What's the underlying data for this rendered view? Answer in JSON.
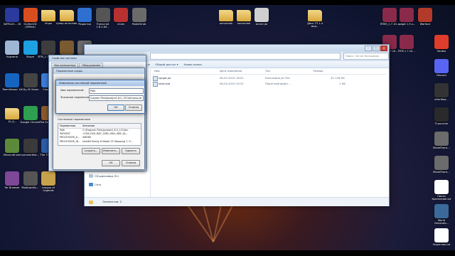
{
  "desktop": {
    "icons_left": [
      {
        "label": "VAPELUC... ID",
        "icon": "app-icon",
        "color": "#2b3a9c"
      },
      {
        "label": "Outline2D (Offline)",
        "icon": "app-icon",
        "color": "#d94e1f"
      },
      {
        "label": "Игры",
        "icon": "folder-icon",
        "color": "#e8c25a"
      },
      {
        "label": "супер источник",
        "icon": "folder-icon",
        "color": "#e8c25a"
      },
      {
        "label": "Редактор",
        "icon": "app-icon",
        "color": "#2f6fd0"
      },
      {
        "label": "Transcript 1.8.2.84...",
        "icon": "app-icon",
        "color": "#555555"
      },
      {
        "label": "vCam",
        "icon": "app-icon",
        "color": "#b73131"
      },
      {
        "label": "ModelGrab",
        "icon": "app-icon",
        "color": "#6b6b6b"
      },
      {
        "label": "Корзина",
        "icon": "trash-icon",
        "color": "#9fb7d4"
      },
      {
        "label": "Skype",
        "icon": "skype-icon",
        "color": "#1da1e2"
      },
      {
        "label": "RTM_1.7.10 Trial",
        "icon": "app-icon",
        "color": "#3d3d3d"
      },
      {
        "label": "Tac_Mash...",
        "icon": "app-icon",
        "color": "#7a5a30"
      },
      {
        "label": "ModelTrans...",
        "icon": "app-icon",
        "color": "#6b6b6b"
      },
      {
        "label": "ModelTrans...",
        "icon": "app-icon",
        "color": "#6b6b6b"
      },
      {
        "label": "Acrobat Reader DC",
        "icon": "acrobat-icon",
        "color": "#d81f1f"
      },
      {
        "label": "mcte",
        "icon": "app-icon",
        "color": "#3a3a3a"
      },
      {
        "label": "TeamViewer 14",
        "icon": "teamviewer-icon",
        "color": "#1565c0"
      },
      {
        "label": "City Of Vision",
        "icon": "app-icon",
        "color": "#444444"
      },
      {
        "label": "Cloudish",
        "icon": "app-icon",
        "color": "#3b7bd6"
      },
      {
        "label": "Downloads",
        "icon": "folder-icon",
        "color": "#e8c25a"
      },
      {
        "label": "desktop.ini",
        "icon": "file-icon",
        "color": "#cccccc"
      },
      {
        "label": "Brit...",
        "icon": "app-icon",
        "color": "#777777"
      },
      {
        "label": "Epic Games Launcher",
        "icon": "epic-icon",
        "color": "#222222"
      },
      {
        "label": "stations_mod",
        "icon": "folder-icon",
        "color": "#e8c25a"
      },
      {
        "label": "10_fj...",
        "icon": "folder-icon",
        "color": "#e8c25a"
      },
      {
        "label": "Google Chrome",
        "icon": "chrome-icon",
        "color": "#2e9e4f"
      },
      {
        "label": "The Escapists",
        "icon": "game-icon",
        "color": "#8a5a2b"
      },
      {
        "label": "ирис 2.1.2.76...",
        "icon": "app-icon",
        "color": "#5f8f3a"
      },
      {
        "label": "MRLaunch...",
        "icon": "app-icon",
        "color": "#444444"
      },
      {
        "label": "Rocket... OEP13",
        "icon": "app-icon",
        "color": "#555555"
      },
      {
        "label": "OBS Studio",
        "icon": "obs-icon",
        "color": "#302e31"
      },
      {
        "label": "MSI Afterburner",
        "icon": "msi-icon",
        "color": "#b71c1c"
      },
      {
        "label": "Minecraft.exe",
        "icon": "minecraft-icon",
        "color": "#5d8a3a"
      },
      {
        "label": "summerfest...",
        "icon": "app-icon",
        "color": "#3a3a3a"
      },
      {
        "label": "The Thunder",
        "icon": "app-icon",
        "color": "#2b5ea8"
      },
      {
        "label": "The Escapists 2",
        "icon": "game-icon",
        "color": "#8a5a2b"
      },
      {
        "label": "QBitF 2.10.10",
        "icon": "app-icon",
        "color": "#777777"
      },
      {
        "label": "OpenVPN GUI",
        "icon": "openvpn-icon",
        "color": "#e05a1c"
      },
      {
        "label": "AutoClicker",
        "icon": "app-icon",
        "color": "#4a4a4a"
      },
      {
        "label": "scd_pack_3...",
        "icon": "app-icon",
        "color": "#6a6a6a"
      },
      {
        "label": "Tor Browser",
        "icon": "tor-icon",
        "color": "#7e4798"
      },
      {
        "label": "ModLoad0x...",
        "icon": "app-icon",
        "color": "#555555"
      },
      {
        "label": "League of Legends",
        "icon": "lol-icon",
        "color": "#c8a24a"
      }
    ],
    "icons_top_right": [
      {
        "label": "servachok",
        "icon": "folder-icon",
        "color": "#e8c25a"
      },
      {
        "label": "servachok",
        "icon": "folder-icon",
        "color": "#e8c25a"
      },
      {
        "label": "server.jar",
        "icon": "file-icon",
        "color": "#cfcfcf"
      },
      {
        "label": "Диск ТЗ 1.4 мод...",
        "icon": "folder-icon",
        "color": "#e8c25a"
      },
      {
        "label": "RTM0_1.7.10...",
        "icon": "app-icon",
        "color": "#8a2a4a"
      },
      {
        "label": "spigot 1.9.x...",
        "icon": "app-icon",
        "color": "#8a2a4a"
      },
      {
        "label": "Warface",
        "icon": "app-icon",
        "color": "#b33a2a"
      },
      {
        "label": "RTM 1.7.10...",
        "icon": "app-icon",
        "color": "#8a2a4a"
      },
      {
        "label": "RTM 1.7.10...",
        "icon": "app-icon",
        "color": "#8a2a4a"
      }
    ],
    "icons_right": [
      {
        "label": "Yandex",
        "icon": "yandex-icon",
        "color": "#e03c2b"
      },
      {
        "label": "Discord",
        "icon": "discord-icon",
        "color": "#5865f2"
      },
      {
        "label": "uHerMod...",
        "icon": "app-icon",
        "color": "#333333"
      },
      {
        "label": "TLauncher",
        "icon": "tlauncher-icon",
        "color": "#2a2a2a"
      },
      {
        "label": "ModelTrans...",
        "icon": "app-icon",
        "color": "#6b6b6b"
      },
      {
        "label": "ModelTrans...",
        "icon": "app-icon",
        "color": "#6b6b6b"
      },
      {
        "label": "Пикси Крепление.txt",
        "icon": "file-icon",
        "color": "#ffffff"
      },
      {
        "label": "World Generato...",
        "icon": "app-icon",
        "color": "#3b6a9a"
      },
      {
        "label": "Лицензия.txt",
        "icon": "file-icon",
        "color": "#ffffff"
      }
    ]
  },
  "explorer": {
    "search_placeholder": "Поиск: Server Валькирия",
    "toolbar": [
      "Упорядочить ▾",
      "Добавить в библиотеку ▾",
      "Общий доступ ▾",
      "Новая папка"
    ],
    "columns": [
      "Имя",
      "Дата изменения",
      "Тип",
      "Размер"
    ],
    "files": [
      {
        "name": "spigot.jar",
        "date": "08.05.2019 16:01",
        "type": "Executable Jar File",
        "size": "20 128 КБ"
      },
      {
        "name": "start.bat",
        "date": "08.05.2019 15:31",
        "type": "Пакетный файл ...",
        "size": "1 КБ"
      }
    ],
    "nav": {
      "drive": "CD-дисковод (H:)",
      "network": "Сеть"
    },
    "status": "Элементов: 2"
  },
  "system_properties": {
    "title": "Свойства системы",
    "tabs": [
      "Имя компьютера",
      "Оборудование",
      "Дополнительно",
      "Защита системы",
      "Удаленный доступ"
    ]
  },
  "env_vars": {
    "title": "Переменные среды",
    "system_section": "Системные переменные",
    "columns": [
      "Переменная",
      "Значение"
    ],
    "rows": [
      {
        "name": "Path",
        "value": "C:\\Program Files\\Java\\jre1.8.0_121\\bin"
      },
      {
        "name": "PATHEXT",
        "value": ".COM;.EXE;.BAT;.CMD;.VBS;.VBE;.JS;..."
      },
      {
        "name": "PROCESSOR_A...",
        "value": "AMD64"
      },
      {
        "name": "PROCESSOR_ID...",
        "value": "Intel64 Family 6 Model 15 Stepping 7, G..."
      }
    ],
    "buttons": {
      "new": "Создать...",
      "edit": "Изменить...",
      "delete": "Удалить",
      "ok": "ОК",
      "cancel": "Отмена"
    }
  },
  "edit_dialog": {
    "title": "Изменение системной переменной",
    "name_label": "Имя переменной:",
    "name_value": "Path",
    "value_label": "Значение переменной:",
    "value_value": "\\rogram Files\\Java\\jre1.8.0_121\\bin;java.jar",
    "ok": "ОК",
    "cancel": "Отмена"
  }
}
